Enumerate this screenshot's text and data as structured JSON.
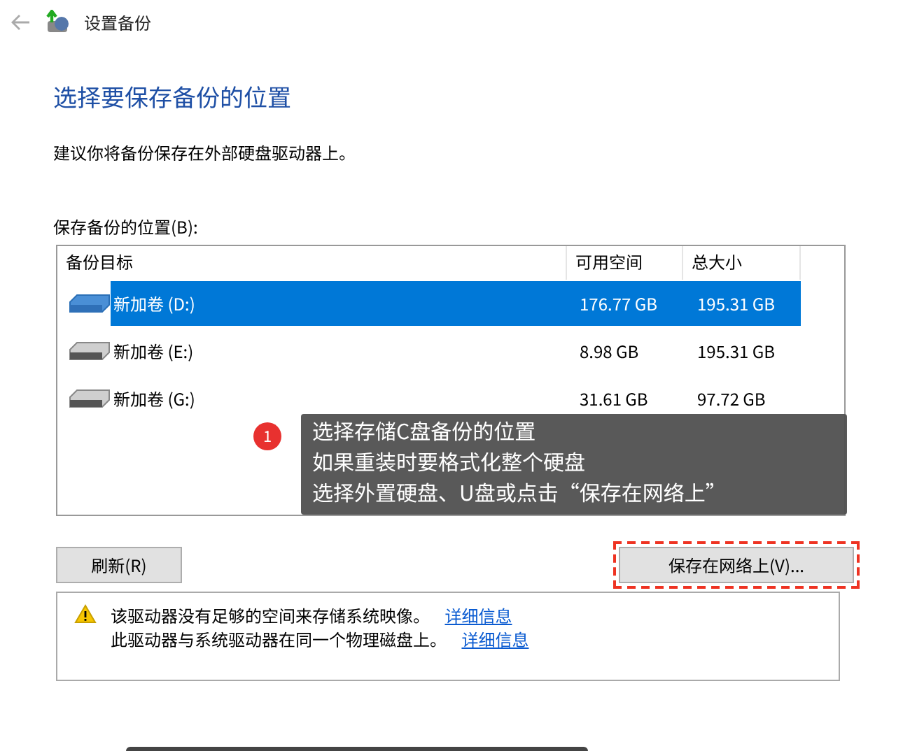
{
  "window": {
    "title": "设置备份"
  },
  "heading": "选择要保存备份的位置",
  "description": "建议你将备份保存在外部硬盘驱动器上。",
  "list_label": "保存备份的位置(B):",
  "table": {
    "columns": [
      "备份目标",
      "可用空间",
      "总大小"
    ],
    "rows": [
      {
        "name": "新加卷 (D:)",
        "free": "176.77 GB",
        "total": "195.31 GB",
        "selected": true
      },
      {
        "name": "新加卷 (E:)",
        "free": "8.98 GB",
        "total": "195.31 GB",
        "selected": false
      },
      {
        "name": "新加卷 (G:)",
        "free": "31.61 GB",
        "total": "97.72 GB",
        "selected": false
      }
    ]
  },
  "callout": {
    "number": "1",
    "lines": [
      "选择存储C盘备份的位置",
      "如果重装时要格式化整个硬盘",
      "选择外置硬盘、U盘或点击“保存在网络上”"
    ]
  },
  "buttons": {
    "refresh": "刷新(R)",
    "save_network": "保存在网络上(V)..."
  },
  "warnings": [
    {
      "text": "该驱动器没有足够的空间来存储系统映像。",
      "link": "详细信息"
    },
    {
      "text": "此驱动器与系统驱动器在同一个物理磁盘上。",
      "link": "详细信息"
    }
  ]
}
